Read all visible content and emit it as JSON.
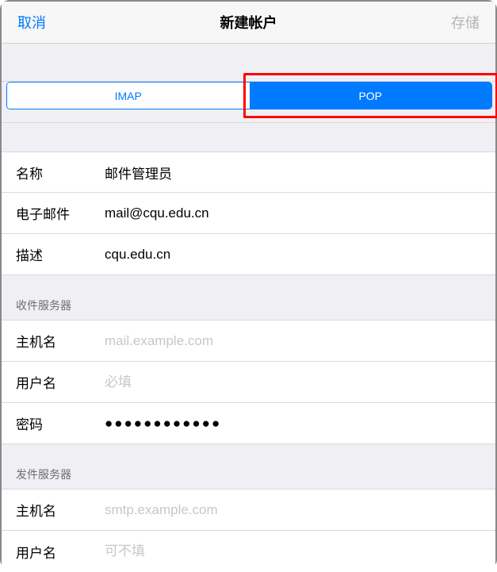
{
  "navbar": {
    "cancel": "取消",
    "title": "新建帐户",
    "save": "存储"
  },
  "segmented": {
    "imap": "IMAP",
    "pop": "POP"
  },
  "account": {
    "name_label": "名称",
    "name_value": "邮件管理员",
    "email_label": "电子邮件",
    "email_value": "mail@cqu.edu.cn",
    "desc_label": "描述",
    "desc_value": "cqu.edu.cn"
  },
  "incoming": {
    "header": "收件服务器",
    "host_label": "主机名",
    "host_placeholder": "mail.example.com",
    "user_label": "用户名",
    "user_placeholder": "必填",
    "pass_label": "密码",
    "pass_value": "●●●●●●●●●●●●"
  },
  "outgoing": {
    "header": "发件服务器",
    "host_label": "主机名",
    "host_placeholder": "smtp.example.com",
    "user_label": "用户名",
    "user_placeholder": "可不填"
  }
}
